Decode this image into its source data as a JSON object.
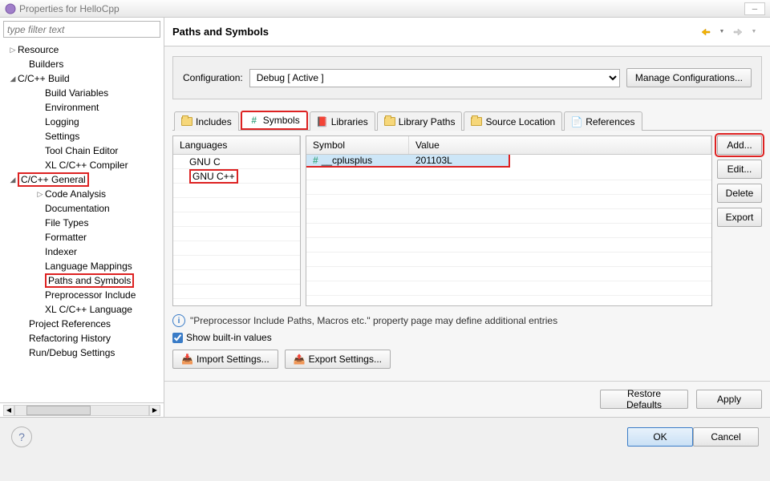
{
  "window": {
    "title": "Properties for HelloCpp"
  },
  "filter": {
    "placeholder": "type filter text"
  },
  "tree": {
    "resource": "Resource",
    "builders": "Builders",
    "ccbuild": "C/C++ Build",
    "buildvars": "Build Variables",
    "environment": "Environment",
    "logging": "Logging",
    "settings": "Settings",
    "toolchain": "Tool Chain Editor",
    "xlcomp": "XL C/C++ Compiler",
    "ccgeneral": "C/C++ General",
    "codeanalysis": "Code Analysis",
    "documentation": "Documentation",
    "filetypes": "File Types",
    "formatter": "Formatter",
    "indexer": "Indexer",
    "langmap": "Language Mappings",
    "paths": "Paths and Symbols",
    "preproc": "Preprocessor Include",
    "xllang": "XL C/C++ Language",
    "projrefs": "Project References",
    "refhist": "Refactoring History",
    "rundebug": "Run/Debug Settings"
  },
  "page": {
    "title": "Paths and Symbols",
    "config_label": "Configuration:",
    "config_value": "Debug  [ Active ]",
    "manage_btn": "Manage Configurations..."
  },
  "tabs": {
    "includes": "Includes",
    "symbols": "Symbols",
    "libraries": "Libraries",
    "libpaths": "Library Paths",
    "srcloc": "Source Location",
    "refs": "References"
  },
  "lang": {
    "header": "Languages",
    "gnuc": "GNU C",
    "gnucpp": "GNU C++"
  },
  "sym": {
    "col_symbol": "Symbol",
    "col_value": "Value",
    "name": "__cplusplus",
    "value": "201103L"
  },
  "side_btns": {
    "add": "Add...",
    "edit": "Edit...",
    "delete": "Delete",
    "export": "Export"
  },
  "info": "\"Preprocessor Include Paths, Macros etc.\" property page may define additional entries",
  "show_builtin": "Show built-in values",
  "import_btn": "Import Settings...",
  "export_btn": "Export Settings...",
  "restore": "Restore Defaults",
  "apply": "Apply",
  "ok": "OK",
  "cancel": "Cancel"
}
